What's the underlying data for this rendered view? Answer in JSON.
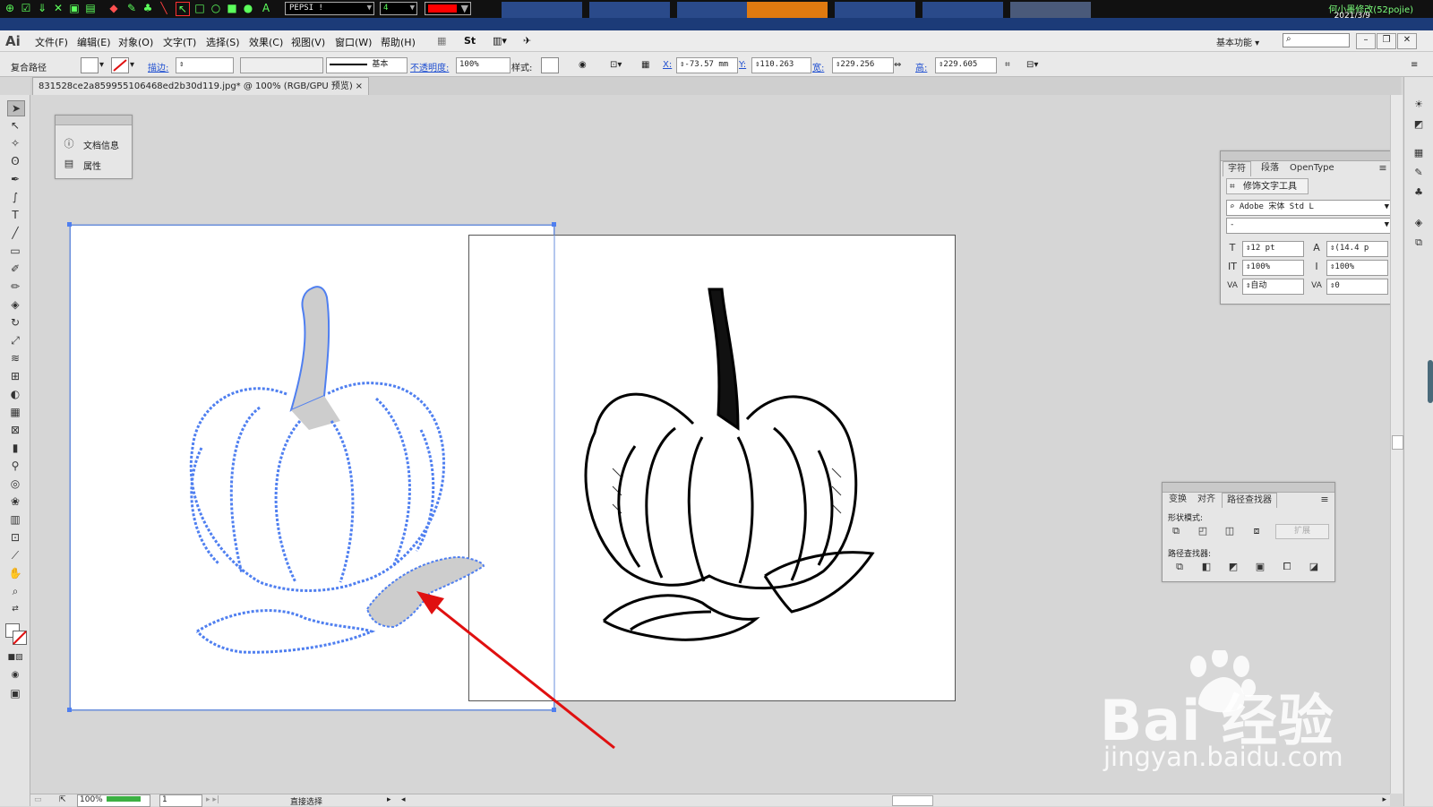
{
  "topbar": {
    "font_name": "PEPSI !",
    "font_size": "4",
    "stroke_color": "#ff0000",
    "user": "何小墨修改(52pojie)",
    "date": "2021/3/9"
  },
  "app": {
    "logo": "Ai"
  },
  "menu": [
    "文件(F)",
    "编辑(E)",
    "对象(O)",
    "文字(T)",
    "选择(S)",
    "效果(C)",
    "视图(V)",
    "窗口(W)",
    "帮助(H)"
  ],
  "workspace": "基本功能",
  "control": {
    "selection_type": "复合路径",
    "stroke_label": "描边:",
    "stroke_profile": "基本",
    "opacity_label": "不透明度:",
    "opacity_value": "100%",
    "style_label": "样式:",
    "x_label": "X:",
    "x_value": "-73.57 mm",
    "y_label": "Y:",
    "y_value": "110.263",
    "w_label": "宽:",
    "w_value": "229.256",
    "h_label": "高:",
    "h_value": "229.605"
  },
  "document": {
    "tab_title": "831528ce2a859955106468ed2b30d119.jpg* @ 100% (RGB/GPU 预览)",
    "close": "×"
  },
  "info_panel": {
    "items": [
      "文档信息",
      "属性"
    ]
  },
  "char_panel": {
    "tabs": [
      "字符",
      "段落",
      "OpenType"
    ],
    "touch_tool": "修饰文字工具",
    "font_family": "Adobe 宋体 Std L",
    "font_style": "-",
    "font_size": "12 pt",
    "leading": "(14.4 p",
    "vscale": "100%",
    "hscale": "100%",
    "kerning": "自动",
    "tracking": "0"
  },
  "pathfinder_panel": {
    "tabs": [
      "变换",
      "对齐",
      "路径查找器"
    ],
    "shape_modes_label": "形状模式:",
    "expand_label": "扩展",
    "pathfinders_label": "路径查找器:"
  },
  "status": {
    "zoom": "100%",
    "artboard_num": "1",
    "tool_name": "直接选择"
  },
  "watermark": {
    "brand": "Bai 经验",
    "url": "jingyan.baidu.com"
  },
  "colors": {
    "selection_blue": "#4f7ff0",
    "arrow_red": "#e01010",
    "ui_gray": "#d6d6d6"
  }
}
